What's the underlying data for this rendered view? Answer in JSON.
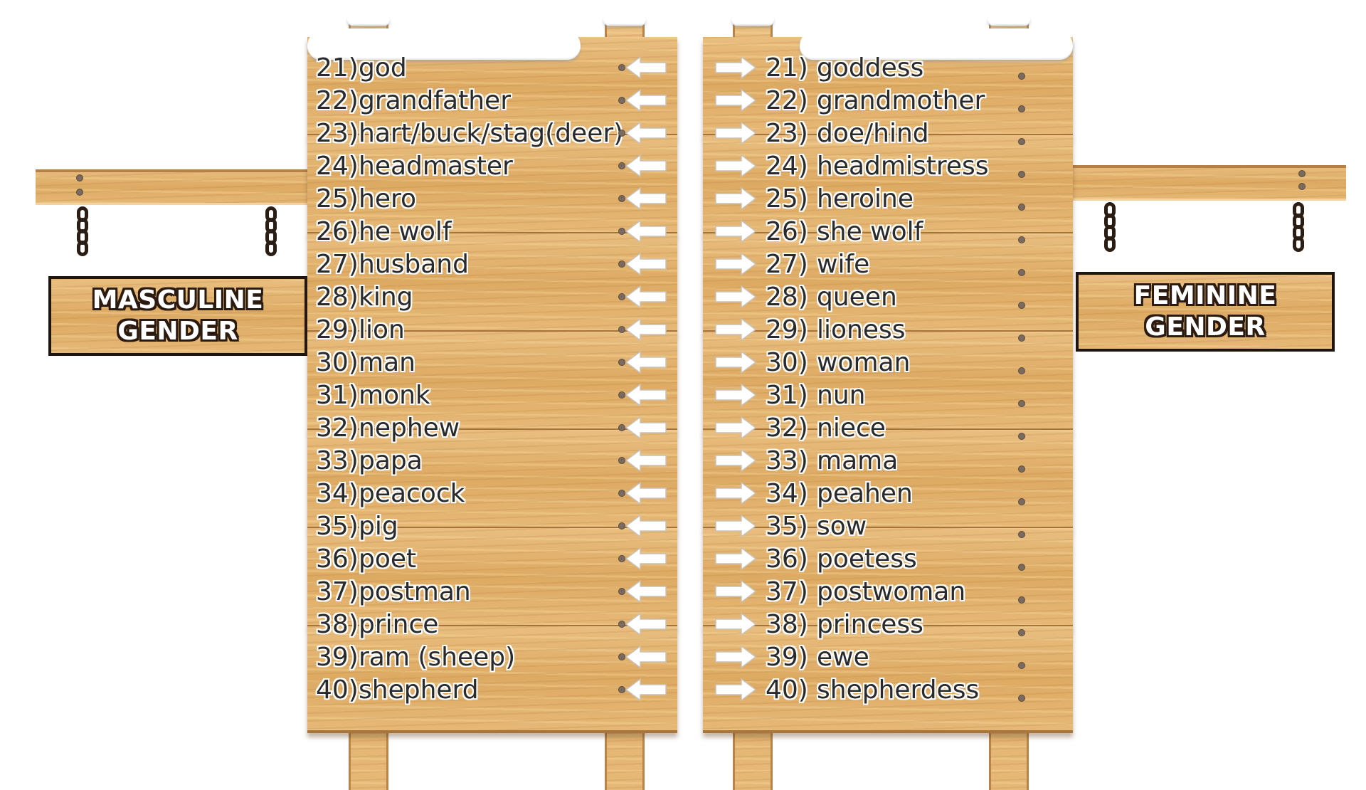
{
  "signs": {
    "masculine": {
      "line1": "MASCULINE",
      "line2": "GENDER"
    },
    "feminine": {
      "line1": "FEMININE",
      "line2": "GENDER"
    }
  },
  "masculine": [
    {
      "num": "21)",
      "word": "god"
    },
    {
      "num": "22)",
      "word": "grandfather"
    },
    {
      "num": "23)",
      "word": "hart/buck/stag(deer)"
    },
    {
      "num": "24)",
      "word": "headmaster"
    },
    {
      "num": "25)",
      "word": "hero"
    },
    {
      "num": "26)",
      "word": "he wolf"
    },
    {
      "num": "27)",
      "word": "husband"
    },
    {
      "num": "28)",
      "word": "king"
    },
    {
      "num": "29)",
      "word": "lion"
    },
    {
      "num": "30)",
      "word": "man"
    },
    {
      "num": "31)",
      "word": "monk"
    },
    {
      "num": "32)",
      "word": "nephew"
    },
    {
      "num": "33)",
      "word": "papa"
    },
    {
      "num": "34)",
      "word": "peacock"
    },
    {
      "num": "35)",
      "word": "pig"
    },
    {
      "num": "36)",
      "word": "poet"
    },
    {
      "num": "37)",
      "word": "postman"
    },
    {
      "num": "38)",
      "word": "prince"
    },
    {
      "num": "39)",
      "word": "ram (sheep)"
    },
    {
      "num": "40)",
      "word": "shepherd"
    }
  ],
  "feminine": [
    {
      "num": "21)",
      "word": "goddess"
    },
    {
      "num": "22)",
      "word": "grandmother"
    },
    {
      "num": "23)",
      "word": "doe/hind"
    },
    {
      "num": "24)",
      "word": "headmistress"
    },
    {
      "num": "25)",
      "word": "heroine"
    },
    {
      "num": "26)",
      "word": "she wolf"
    },
    {
      "num": "27)",
      "word": "wife"
    },
    {
      "num": "28)",
      "word": "queen"
    },
    {
      "num": "29)",
      "word": "lioness"
    },
    {
      "num": "30)",
      "word": "woman"
    },
    {
      "num": "31)",
      "word": "nun"
    },
    {
      "num": "32)",
      "word": "niece"
    },
    {
      "num": "33)",
      "word": "mama"
    },
    {
      "num": "34)",
      "word": "peahen"
    },
    {
      "num": "35)",
      "word": "sow"
    },
    {
      "num": "36)",
      "word": "poetess"
    },
    {
      "num": "37)",
      "word": "postwoman"
    },
    {
      "num": "38)",
      "word": "princess"
    },
    {
      "num": "39)",
      "word": "ewe"
    },
    {
      "num": "40)",
      "word": "shepherdess"
    }
  ],
  "icons": {
    "left_arrow": "arrow-left-icon",
    "right_arrow": "arrow-right-icon"
  },
  "colors": {
    "wood": "#e2b06c",
    "wood_dark": "#b9844a",
    "sign_border": "#1f1510",
    "text": "#2a2a2a",
    "snow": "#ffffff"
  }
}
